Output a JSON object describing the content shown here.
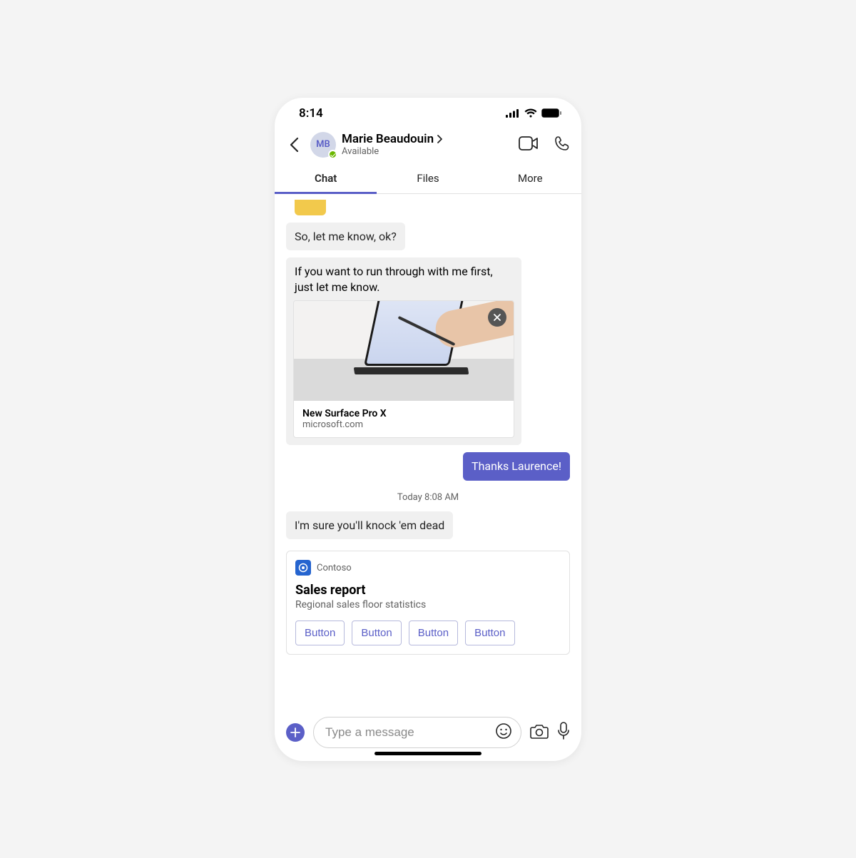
{
  "status_bar": {
    "time": "8:14"
  },
  "header": {
    "avatar_initials": "MB",
    "name": "Marie Beaudouin",
    "presence_text": "Available"
  },
  "tabs": {
    "chat": "Chat",
    "files": "Files",
    "more": "More",
    "active": "chat"
  },
  "messages": {
    "m1": "So, let me know, ok?",
    "m2": "If you want to run through with me first, just let me know.",
    "link_preview": {
      "title": "New Surface Pro X",
      "domain": "microsoft.com"
    },
    "m3": "Thanks Laurence!",
    "timestamp": "Today 8:08 AM",
    "m4": "I'm sure you'll knock 'em dead"
  },
  "card": {
    "app_name": "Contoso",
    "title": "Sales report",
    "subtitle": "Regional sales floor statistics",
    "buttons": [
      "Button",
      "Button",
      "Button",
      "Button"
    ]
  },
  "composer": {
    "placeholder": "Type a message"
  }
}
